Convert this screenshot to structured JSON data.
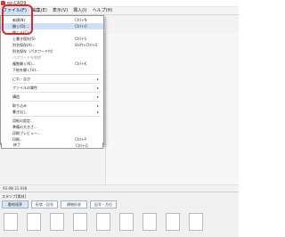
{
  "window": {
    "title": "ez-CAD9"
  },
  "menubar": {
    "items": [
      {
        "label": "ファイル(F)",
        "active": true
      },
      {
        "label": "編集(E)"
      },
      {
        "label": "表示(V)"
      },
      {
        "label": "挿入(I)"
      },
      {
        "label": "ヘルプ(H)"
      }
    ]
  },
  "file_menu": {
    "items": [
      {
        "label": "新規(N)",
        "shortcut": "Ctrl+N"
      },
      {
        "label": "開く(O)...",
        "shortcut": "Ctrl+O",
        "hover": true
      },
      {
        "label": "閉じる(C)"
      },
      {
        "label": "上書き保存(S)",
        "shortcut": "Ctrl+S"
      },
      {
        "label": "別名保存(A)...",
        "shortcut": "Shift+Ctrl+S"
      },
      {
        "label": "別名保存（パスワード付）"
      },
      {
        "label": "パスワードを削除",
        "disabled": true
      },
      {
        "label": "複数開く(K)...",
        "shortcut": "Ctrl+K"
      },
      {
        "label": "下絵を開く(U)..."
      },
      {
        "label": "にわ・なび",
        "submenu": true
      },
      {
        "label": "ファイルの属性",
        "submenu": true
      },
      {
        "label": "構造",
        "submenu": true
      },
      {
        "label": "取り込み",
        "submenu": true
      },
      {
        "label": "書き出し",
        "submenu": true
      },
      {
        "label": "用紙の設定..."
      },
      {
        "label": "準備の大きさ..."
      },
      {
        "label": "印刷プレビュー..."
      },
      {
        "label": "印刷...",
        "shortcut": "Ctrl+P"
      },
      {
        "label": "終了",
        "shortcut": "Ctrl+Q"
      }
    ]
  },
  "status": {
    "coordinates": "93.9N 31.938"
  },
  "stamp_panel": {
    "title": "スタンプ[素材]",
    "tabs": [
      "敷地境界",
      "形状・記号",
      "建物形状",
      "記号・方位"
    ]
  },
  "colors": {
    "highlight_red": "#e1252b",
    "menu_hover": "#cde0f5"
  }
}
